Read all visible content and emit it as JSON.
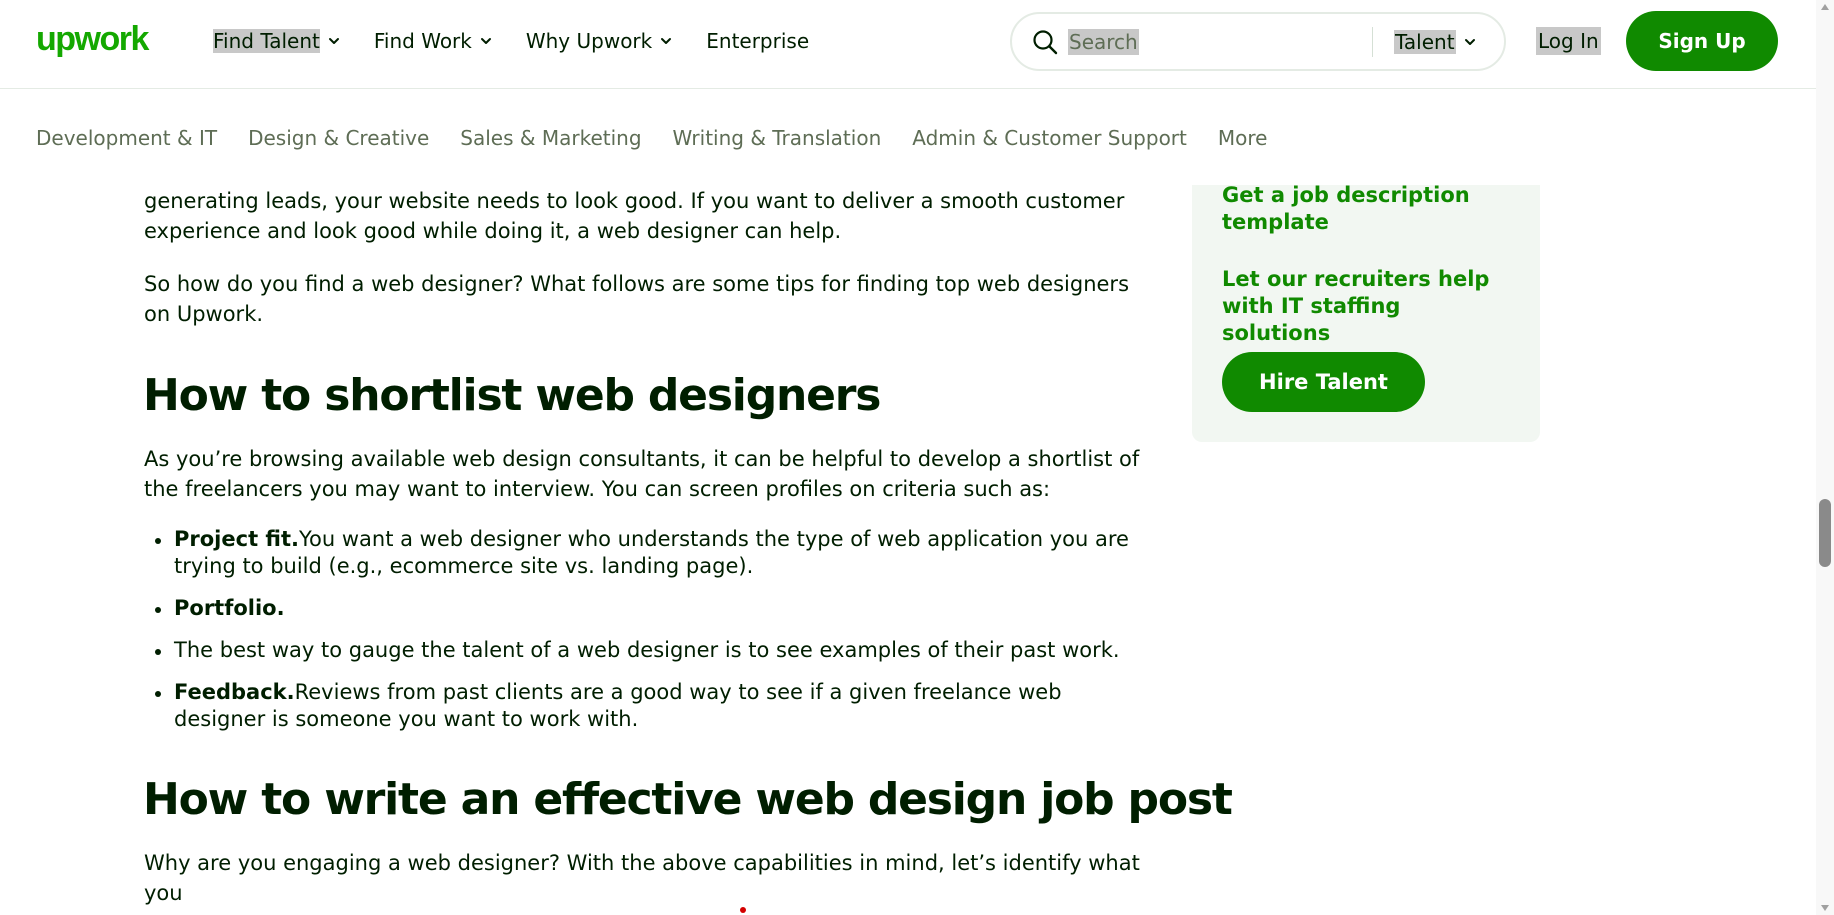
{
  "header": {
    "logo_text": "upwork",
    "nav": [
      {
        "label": "Find Talent",
        "dropdown": true,
        "selected": true
      },
      {
        "label": "Find Work",
        "dropdown": true,
        "selected": false
      },
      {
        "label": "Why Upwork",
        "dropdown": true,
        "selected": false
      },
      {
        "label": "Enterprise",
        "dropdown": false,
        "selected": false
      }
    ],
    "search": {
      "placeholder": "Search",
      "type_label": "Talent"
    },
    "login_label": "Log In",
    "signup_label": "Sign Up"
  },
  "categories": [
    "Development & IT",
    "Design & Creative",
    "Sales & Marketing",
    "Writing & Translation",
    "Admin & Customer Support",
    "More"
  ],
  "article": {
    "lead_para": "generating leads, your website needs to look good. If you want to deliver a smooth customer experience and look good while doing it, a web designer can help.",
    "para2": "So how do you find a web designer? What follows are some tips for finding top web designers on Upwork.",
    "heading_shortlist": "How to shortlist web designers",
    "para3": "As you’re browsing available web design consultants, it can be helpful to develop a shortlist of the freelancers you may want to interview. You can screen profiles on criteria such as:",
    "list": [
      {
        "bold": "Project fit.",
        "text": "You want a web designer who understands the type of web application you are trying to build (e.g., ecommerce site vs. landing page)."
      },
      {
        "bold": "Portfolio.",
        "text": ""
      },
      {
        "bold": "",
        "text": "The best way to gauge the talent of a web designer is to see examples of their past work."
      },
      {
        "bold": "Feedback.",
        "text": "Reviews from past clients are a good way to see if a given freelance web designer is someone you want to work with."
      }
    ],
    "heading_jobpost": "How to write an effective web design job post",
    "para4": "Why are you engaging a web designer? With the above capabilities in mind, let’s identify what you"
  },
  "sidebar": {
    "link1": "Get a job description template",
    "link2": "Let our recruiters help with IT staffing solutions",
    "hire_label": "Hire Talent"
  },
  "colors": {
    "brand_green": "#108a00",
    "text_dark": "#001e00",
    "muted": "#5e6d55",
    "card_bg": "#f2f7f2"
  }
}
